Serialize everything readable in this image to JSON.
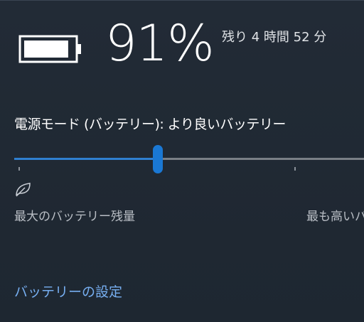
{
  "battery": {
    "percent_text": "91%",
    "level": 0.91,
    "time_remaining": "残り 4 時間 52 分"
  },
  "power_mode": {
    "label": "電源モード (バッテリー): より良いバッテリー",
    "slider_value": 0.41,
    "min_label": "最大のバッテリー残量",
    "max_label": "最も高いパ",
    "min_icon": "leaf-icon"
  },
  "settings_link": "バッテリーの設定",
  "colors": {
    "background": "#1f2833",
    "accent": "#1a78d4",
    "link": "#76aef0",
    "track_inactive": "#7a7f86"
  }
}
